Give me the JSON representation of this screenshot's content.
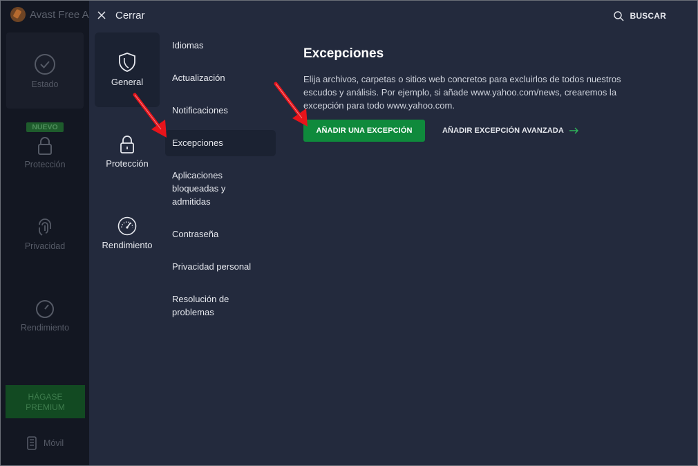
{
  "background_app": {
    "title": "Avast Free A",
    "nav": [
      {
        "label": "Estado",
        "icon": "check-circle-icon"
      },
      {
        "label": "Protección",
        "icon": "lock-icon",
        "badge": "NUEVO"
      },
      {
        "label": "Privacidad",
        "icon": "fingerprint-icon"
      },
      {
        "label": "Rendimiento",
        "icon": "speedometer-icon"
      }
    ],
    "premium_label": "HÁGASE\nPREMIUM",
    "mobile_label": "Móvil"
  },
  "header": {
    "close_label": "Cerrar",
    "search_label": "BUSCAR"
  },
  "categories": [
    {
      "label": "General",
      "icon": "shield-icon",
      "active": true
    },
    {
      "label": "Protección",
      "icon": "lock-icon",
      "active": false
    },
    {
      "label": "Rendimiento",
      "icon": "speedometer-icon",
      "active": false
    }
  ],
  "subnav": [
    {
      "label": "Idiomas"
    },
    {
      "label": "Actualización"
    },
    {
      "label": "Notificaciones"
    },
    {
      "label": "Excepciones",
      "active": true
    },
    {
      "label": "Aplicaciones bloqueadas y admitidas"
    },
    {
      "label": "Contraseña"
    },
    {
      "label": "Privacidad personal"
    },
    {
      "label": "Resolución de problemas"
    }
  ],
  "content": {
    "title": "Excepciones",
    "description": "Elija archivos, carpetas o sitios web concretos para excluirlos de todos nuestros escudos y análisis. Por ejemplo, si añade www.yahoo.com/news, crearemos la excepción para todo www.yahoo.com.",
    "add_button": "AÑADIR UNA EXCEPCIÓN",
    "advanced_button": "AÑADIR EXCEPCIÓN AVANZADA"
  },
  "colors": {
    "panel_bg": "#232a3d",
    "sidebar_bg": "#131722",
    "accent_green": "#0f8a3c",
    "annotation_red": "#e8141b"
  }
}
